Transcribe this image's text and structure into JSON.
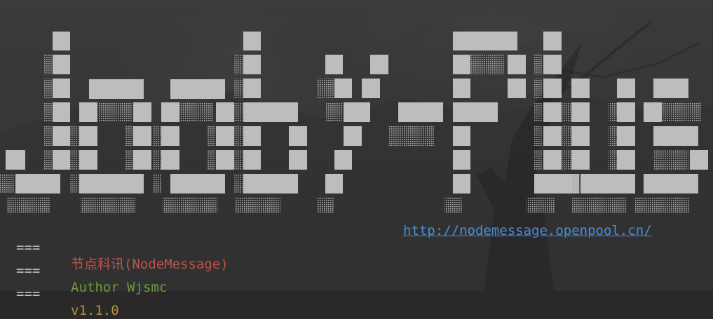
{
  "banner": {
    "text": "Jody-Plus",
    "colors": {
      "block": "#bdbdbd",
      "shade": "#9a9a9a"
    }
  },
  "lines": [
    {
      "prefix": "===",
      "text": "节点科讯(NodeMessage)",
      "color": "#c0524a"
    },
    {
      "prefix": "===",
      "text": "Author Wjsmc",
      "color": "#6a9a3a"
    },
    {
      "prefix": "===",
      "text": "v1.1.0",
      "color": "#b5953a"
    }
  ],
  "link": {
    "text": "http://nodemessage.openpool.cn/",
    "color": "#4a8fd8"
  }
}
